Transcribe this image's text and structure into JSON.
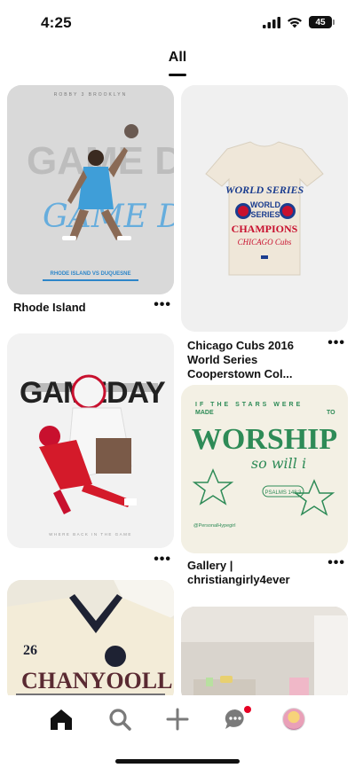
{
  "status_bar": {
    "time": "4:25",
    "battery": "45"
  },
  "tabs": [
    {
      "label": "All",
      "active": true
    }
  ],
  "pins": [
    {
      "title": "Rhode Island",
      "image_text": {
        "header": "ROBBY 3 BROOKLYN",
        "big": "GAME DAY",
        "script": "GAME DAY",
        "caption": "RHODE ISLAND VS DUQUESNE"
      }
    },
    {
      "title": "Chicago Cubs 2016 World Series Cooperstown Col...",
      "image_text": {
        "line1": "WORLD SERIES",
        "line2": "WORLD",
        "line3": "SERIES",
        "line4": "CHAMPIONS",
        "line5": "CHICAGO Cubs"
      }
    },
    {
      "title": "",
      "image_text": {
        "big": "GAMEDAY",
        "caption": "WHERE BACK IN THE GAME"
      }
    },
    {
      "title": "Gallery | christiangirly4ever",
      "image_text": {
        "top_left": "IF THE STARS WERE",
        "top_right": "TO",
        "line2": "MADE",
        "big": "WORSHIP",
        "script": "so will i",
        "verse": "PSALMS 148:3",
        "handle": "@PersonalHypegirl"
      }
    },
    {
      "title": "",
      "image_text": {
        "number": "26",
        "name": "CHANYOOLL"
      }
    },
    {
      "title": ""
    }
  ],
  "nav": {
    "items": [
      "home",
      "search",
      "create",
      "messages",
      "profile"
    ]
  },
  "colors": {
    "notification_dot": "#e60023",
    "worship_green": "#2e8b57",
    "cubs_blue": "#1b3d8f",
    "cubs_red": "#c8102e"
  }
}
